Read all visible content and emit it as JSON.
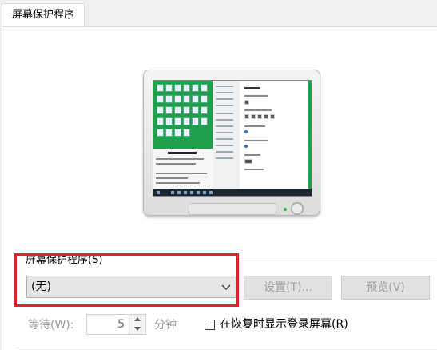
{
  "tab": {
    "label": "屏幕保护程序"
  },
  "group": {
    "label": "屏幕保护程序(S)"
  },
  "screensaver_select": {
    "value": "(无)"
  },
  "buttons": {
    "settings": "设置(T)...",
    "preview": "预览(V)"
  },
  "wait": {
    "label": "等待(W):",
    "value": "5",
    "unit": "分钟"
  },
  "resume_checkbox": {
    "label": "在恢复时显示登录屏幕(R)",
    "checked": false
  },
  "colors": {
    "highlight": "#d8232a",
    "desktop": "#1fa04a",
    "disabled_text": "#a0a0a0"
  }
}
